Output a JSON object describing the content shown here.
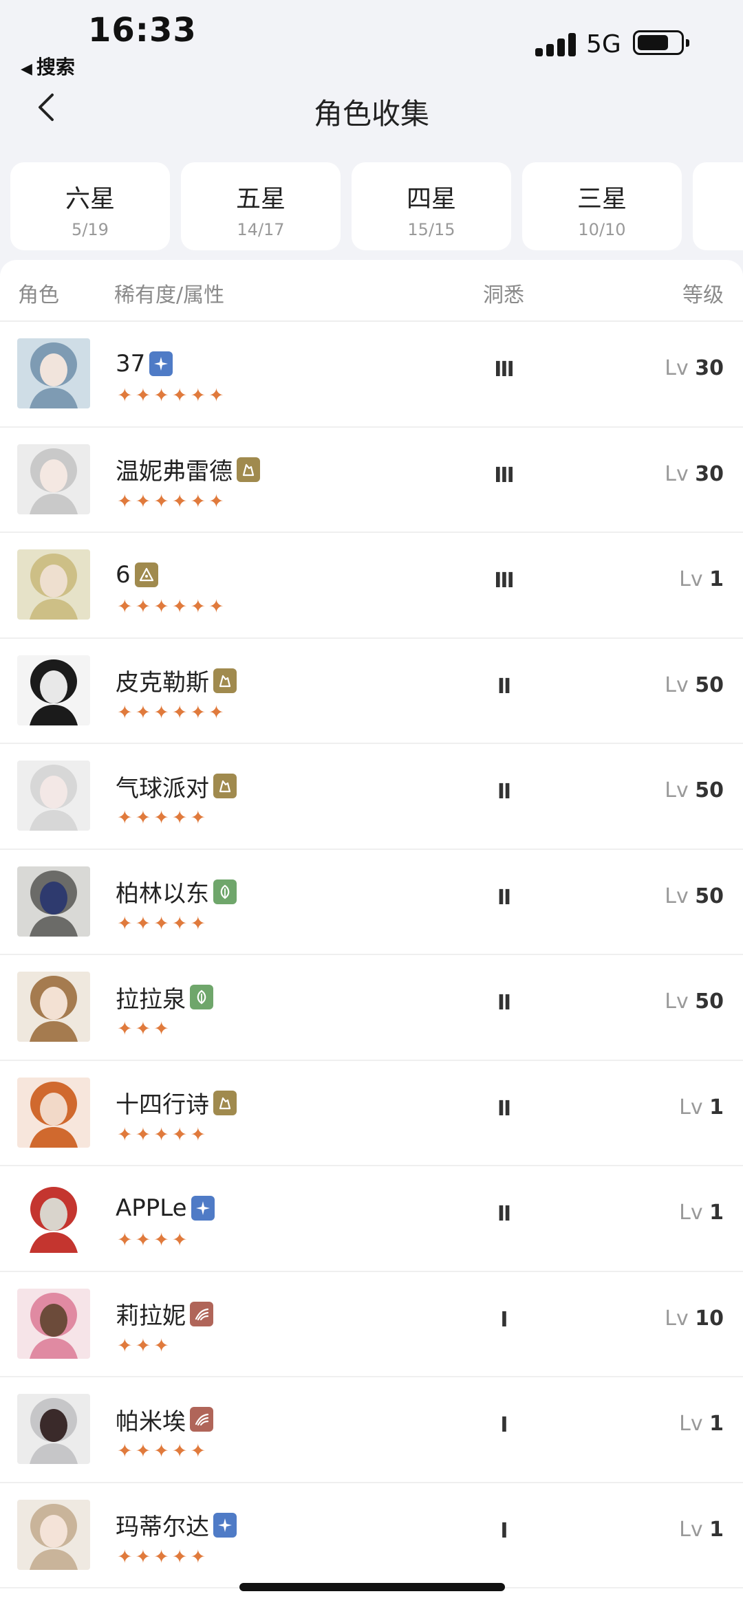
{
  "status_bar": {
    "time": "16:33",
    "back_app": "搜索",
    "network": "5G"
  },
  "nav": {
    "title": "角色收集"
  },
  "tabs": [
    {
      "label": "六星",
      "count": "5/19"
    },
    {
      "label": "五星",
      "count": "14/17"
    },
    {
      "label": "四星",
      "count": "15/15"
    },
    {
      "label": "三星",
      "count": "10/10"
    }
  ],
  "header": {
    "role": "角色",
    "rarity": "稀有度/属性",
    "insight": "洞悉",
    "level": "等级"
  },
  "attribute_colors": {
    "star": "#4f7bc6",
    "mineral": "#a08a4e",
    "pyramid": "#a08a4e",
    "plant": "#6fa66b",
    "beast": "#b06559"
  },
  "characters": [
    {
      "name": "37",
      "attribute": "star",
      "stars": "✦✦✦✦✦✦",
      "insight": "III",
      "lv": "Lv",
      "level": "30"
    },
    {
      "name": "温妮弗雷德",
      "attribute": "mineral",
      "stars": "✦✦✦✦✦✦",
      "insight": "III",
      "lv": "Lv",
      "level": "30"
    },
    {
      "name": "6",
      "attribute": "pyramid",
      "stars": "✦✦✦✦✦✦",
      "insight": "III",
      "lv": "Lv",
      "level": "1"
    },
    {
      "name": "皮克勒斯",
      "attribute": "mineral",
      "stars": "✦✦✦✦✦✦",
      "insight": "II",
      "lv": "Lv",
      "level": "50"
    },
    {
      "name": "气球派对",
      "attribute": "mineral",
      "stars": "✦✦✦✦✦",
      "insight": "II",
      "lv": "Lv",
      "level": "50"
    },
    {
      "name": "柏林以东",
      "attribute": "plant",
      "stars": "✦✦✦✦✦",
      "insight": "II",
      "lv": "Lv",
      "level": "50"
    },
    {
      "name": "拉拉泉",
      "attribute": "plant",
      "stars": "✦✦✦",
      "insight": "II",
      "lv": "Lv",
      "level": "50"
    },
    {
      "name": "十四行诗",
      "attribute": "mineral",
      "stars": "✦✦✦✦✦",
      "insight": "II",
      "lv": "Lv",
      "level": "1"
    },
    {
      "name": "APPLe",
      "attribute": "star",
      "stars": "✦✦✦✦",
      "insight": "II",
      "lv": "Lv",
      "level": "1"
    },
    {
      "name": "莉拉妮",
      "attribute": "beast",
      "stars": "✦✦✦",
      "insight": "I",
      "lv": "Lv",
      "level": "10"
    },
    {
      "name": "帕米埃",
      "attribute": "beast",
      "stars": "✦✦✦✦✦",
      "insight": "I",
      "lv": "Lv",
      "level": "1"
    },
    {
      "name": "玛蒂尔达",
      "attribute": "star",
      "stars": "✦✦✦✦✦",
      "insight": "I",
      "lv": "Lv",
      "level": "1"
    }
  ]
}
